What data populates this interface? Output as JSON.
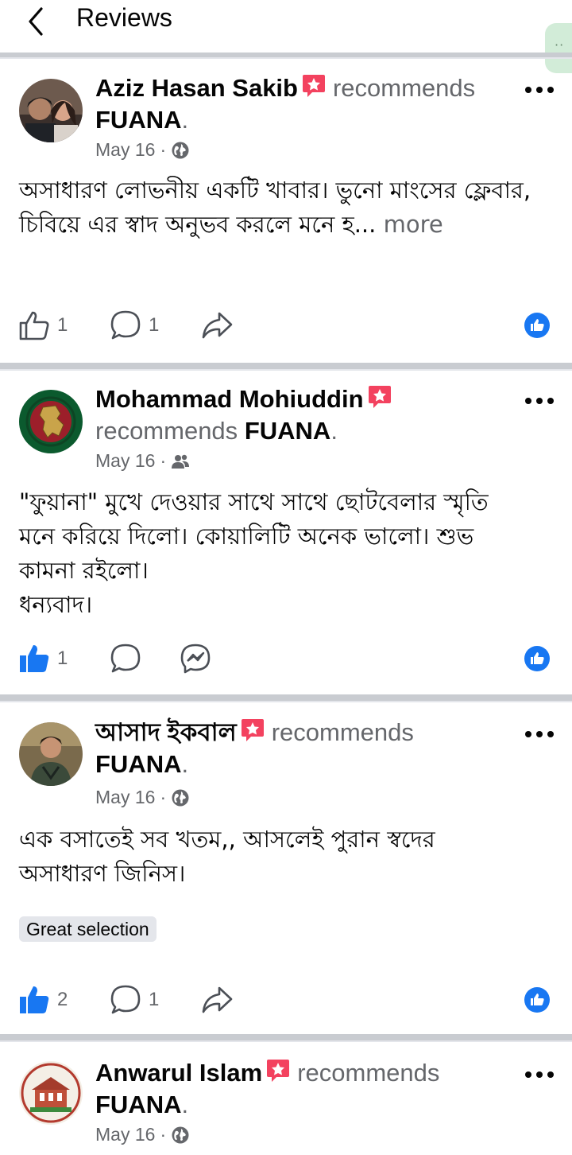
{
  "header": {
    "title": "Reviews"
  },
  "reviews": [
    {
      "author": "Aziz Hasan Sakib",
      "verb": "recommends",
      "page": "FUANA",
      "date": "May 16",
      "privacy_icon": "globe-icon",
      "text": "অসাধারণ লোভনীয় একটি খাবার। ভুনো মাংসের ফ্লেবার, চিবিয়ে এর স্বাদ অনুভব করলে মনে হ...",
      "more_label": "more",
      "likes": "1",
      "comments": "1",
      "liked": false
    },
    {
      "author": "Mohammad Mohiuddin",
      "verb": "recommends",
      "page": "FUANA",
      "date": "May 16",
      "privacy_icon": "friends-icon",
      "text_lines": [
        "\"ফুয়ানা\" মুখে দেওয়ার সাথে সাথে ছোটবেলার স্মৃতি",
        "মনে করিয়ে দিলো। কোয়ালিটি অনেক ভালো। শুভ",
        "কামনা রইলো।",
        "ধন্যবাদ।"
      ],
      "likes": "1",
      "liked": true
    },
    {
      "author": "আসাদ ইকবাল",
      "verb": "recommends",
      "page": "FUANA",
      "date": "May 16",
      "privacy_icon": "globe-icon",
      "text_lines": [
        "এক বসাতেই সব খতম,, আসলেই পুরান স্বদের",
        "অসাধারণ জিনিস।"
      ],
      "tag": "Great selection",
      "likes": "2",
      "comments": "1",
      "liked": true
    },
    {
      "author": "Anwarul Islam",
      "verb": "recommends",
      "page": "FUANA",
      "date": "May 16",
      "privacy_icon": "globe-icon"
    }
  ],
  "colors": {
    "facebook_blue": "#1877f2",
    "secondary_text": "#65676b",
    "recommend_red": "#f3425f",
    "divider": "#c9ccd1"
  }
}
